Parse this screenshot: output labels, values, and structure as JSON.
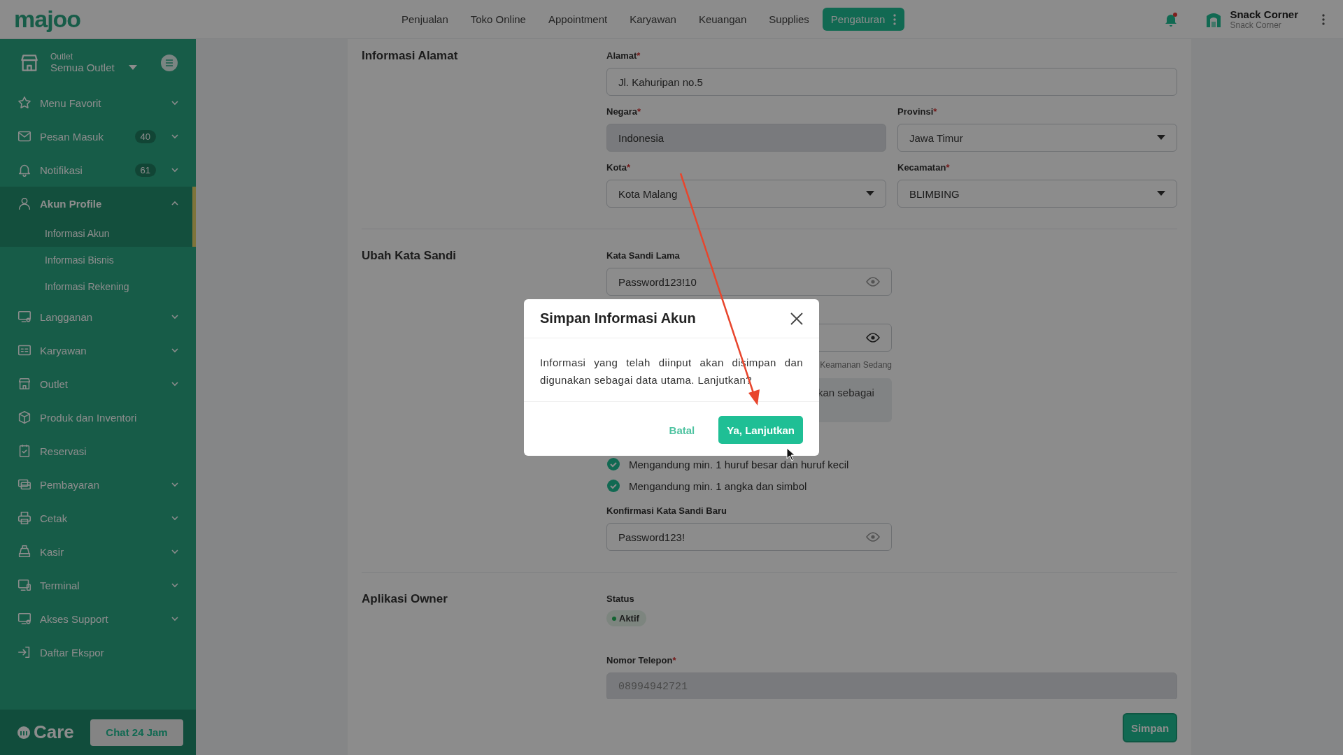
{
  "topbar": {
    "logo": "majoo",
    "nav": [
      {
        "label": "Penjualan",
        "selected": false
      },
      {
        "label": "Toko Online",
        "selected": false
      },
      {
        "label": "Appointment",
        "selected": false
      },
      {
        "label": "Karyawan",
        "selected": false
      },
      {
        "label": "Keuangan",
        "selected": false
      },
      {
        "label": "Supplies",
        "selected": false
      },
      {
        "label": "Pengaturan",
        "selected": true
      }
    ],
    "user": {
      "name": "Snack Corner",
      "outlet": "Snack Corner"
    }
  },
  "sidebar": {
    "outlet": {
      "label": "Outlet",
      "value": "Semua Outlet"
    },
    "items": [
      {
        "label": "Menu Favorit",
        "selected": false,
        "expanded": false
      },
      {
        "label": "Pesan Masuk",
        "badge": "40",
        "selected": false,
        "expanded": false
      },
      {
        "label": "Notifikasi",
        "badge": "61",
        "selected": false,
        "expanded": false
      },
      {
        "label": "Akun Profile",
        "selected": true,
        "expanded": true,
        "children": [
          {
            "label": "Informasi Akun",
            "selected": true
          },
          {
            "label": "Informasi Bisnis",
            "selected": false
          },
          {
            "label": "Informasi Rekening",
            "selected": false
          }
        ]
      },
      {
        "label": "Langganan",
        "selected": false,
        "expanded": false
      },
      {
        "label": "Karyawan",
        "selected": false,
        "expanded": false
      },
      {
        "label": "Outlet",
        "selected": false,
        "expanded": false
      },
      {
        "label": "Produk dan Inventori",
        "selected": false
      },
      {
        "label": "Reservasi",
        "selected": false
      },
      {
        "label": "Pembayaran",
        "selected": false,
        "expanded": false
      },
      {
        "label": "Cetak",
        "selected": false,
        "expanded": false
      },
      {
        "label": "Kasir",
        "selected": false,
        "expanded": false
      },
      {
        "label": "Terminal",
        "selected": false,
        "expanded": false
      },
      {
        "label": "Akses Support",
        "selected": false,
        "expanded": false
      },
      {
        "label": "Daftar Ekspor",
        "selected": false
      }
    ],
    "footer": {
      "brand": "Care",
      "button": "Chat 24 Jam"
    }
  },
  "sections": [
    {
      "title": "Informasi Alamat",
      "items": [
        {
          "kind": "row",
          "fields": [
            {
              "kind": "text",
              "label": "Alamat",
              "required_mark": "*",
              "value": "Jl. Kahuripan no.5",
              "disabled": false
            }
          ]
        },
        {
          "kind": "row",
          "fields": [
            {
              "kind": "text",
              "label": "Negara",
              "required_mark": "*",
              "value": "Indonesia",
              "disabled": true
            },
            {
              "kind": "select",
              "label": "Provinsi",
              "required_mark": "*",
              "value": "Jawa Timur"
            }
          ]
        },
        {
          "kind": "row",
          "fields": [
            {
              "kind": "select",
              "label": "Kota",
              "required_mark": "*",
              "value": "Kota Malang"
            },
            {
              "kind": "select",
              "label": "Kecamatan",
              "required_mark": "*",
              "value": "BLIMBING"
            }
          ]
        }
      ]
    },
    {
      "title": "Ubah Kata Sandi",
      "items": [
        {
          "kind": "row",
          "fields": [
            {
              "kind": "password",
              "label": "Kata Sandi Lama",
              "value": "Password123!10"
            }
          ]
        },
        {
          "kind": "row",
          "fields": [
            {
              "kind": "password"
            }
          ]
        },
        {
          "kind": "strength",
          "text": "Keamanan Sedang"
        },
        {
          "kind": "note",
          "text": "kan sebagai"
        },
        {
          "kind": "check",
          "text": "Mengandung min. 1 huruf besar dan huruf kecil",
          "checked": true
        },
        {
          "kind": "check",
          "text": "Mengandung min. 1 angka dan simbol",
          "checked": true
        },
        {
          "kind": "row",
          "fields": [
            {
              "kind": "password",
              "label": "Konfirmasi Kata Sandi Baru",
              "value": "Password123!"
            }
          ]
        }
      ]
    },
    {
      "title": "Aplikasi Owner",
      "items": [
        {
          "kind": "status",
          "label": "Status",
          "value": "Aktif"
        },
        {
          "kind": "row",
          "fields": [
            {
              "kind": "text",
              "label": "Nomor Telepon",
              "required_mark": "*",
              "value": "08994942721",
              "disabled": true
            }
          ]
        }
      ]
    }
  ],
  "save_button": "Simpan",
  "modal": {
    "title": "Simpan Informasi Akun",
    "body": "Informasi yang telah diinput akan disimpan dan digunakan sebagai data utama. Lanjutkan?",
    "buttons": [
      {
        "kind": "text",
        "label": "Batal"
      },
      {
        "kind": "primary",
        "label": "Ya, Lanjutkan"
      }
    ]
  }
}
